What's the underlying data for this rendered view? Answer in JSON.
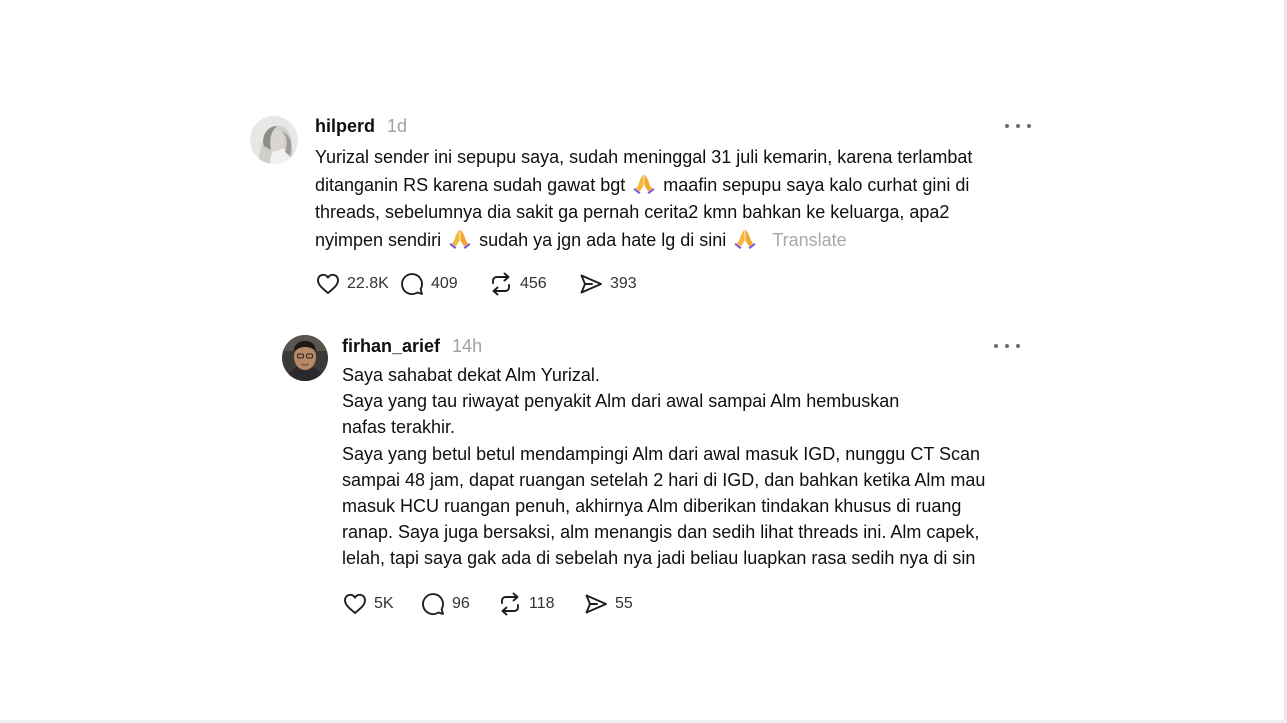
{
  "colors": {
    "text": "#101010",
    "muted": "#a0a0a0",
    "icon": "#1f1f1f",
    "background": "#ffffff"
  },
  "posts": [
    {
      "username": "hilperd",
      "time": "1d",
      "lines": [
        "Yurizal sender ini sepupu saya, sudah meninggal 31 juli kemarin, karena terlambat",
        "ditanganin RS karena sudah gawat bgt",
        "maafin sepupu saya kalo curhat gini di",
        "threads, sebelumnya dia sakit ga pernah cerita2 kmn bahkan ke keluarga, apa2",
        "nyimpen sendiri",
        "sudah ya jgn ada hate lg di sini"
      ],
      "translate_label": "Translate",
      "emoji_name": "folded-hands-emoji",
      "likes": "22.8K",
      "replies": "409",
      "reposts": "456",
      "shares": "393"
    },
    {
      "username": "firhan_arief",
      "time": "14h",
      "lines": [
        "Saya sahabat dekat Alm Yurizal.",
        "Saya yang tau riwayat penyakit Alm dari awal sampai Alm hembuskan",
        "nafas terakhir.",
        "Saya yang betul betul mendampingi Alm dari awal masuk IGD, nunggu CT Scan",
        "sampai 48 jam, dapat ruangan setelah 2 hari di IGD, dan bahkan ketika Alm mau",
        "masuk HCU ruangan penuh, akhirnya Alm diberikan tindakan khusus di ruang",
        "ranap. Saya juga bersaksi, alm menangis dan sedih lihat threads ini. Alm capek,",
        "lelah, tapi saya gak ada di sebelah nya jadi beliau luapkan rasa sedih nya di sin"
      ],
      "likes": "5K",
      "replies": "96",
      "reposts": "118",
      "shares": "55"
    }
  ],
  "icons": {
    "like": "heart-icon",
    "reply": "comment-icon",
    "repost": "repost-icon",
    "share": "share-icon",
    "more": "more-options-icon"
  }
}
